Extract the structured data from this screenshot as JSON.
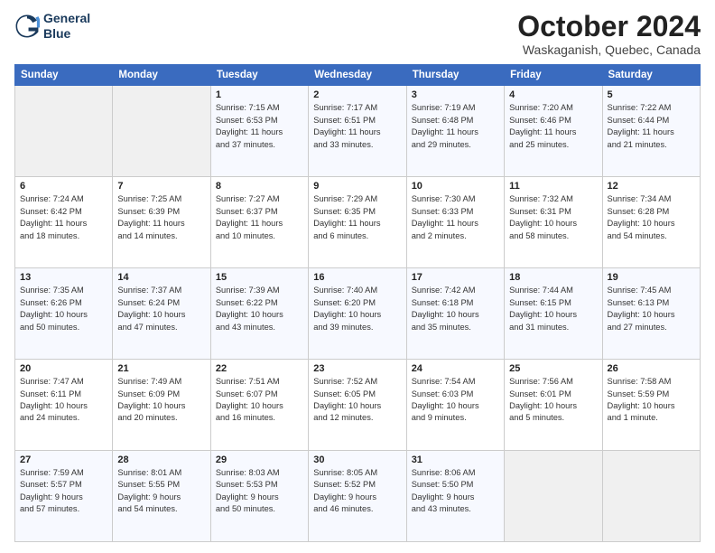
{
  "header": {
    "logo_line1": "General",
    "logo_line2": "Blue",
    "month_title": "October 2024",
    "location": "Waskaganish, Quebec, Canada"
  },
  "weekdays": [
    "Sunday",
    "Monday",
    "Tuesday",
    "Wednesday",
    "Thursday",
    "Friday",
    "Saturday"
  ],
  "weeks": [
    [
      {
        "day": "",
        "info": ""
      },
      {
        "day": "",
        "info": ""
      },
      {
        "day": "1",
        "info": "Sunrise: 7:15 AM\nSunset: 6:53 PM\nDaylight: 11 hours\nand 37 minutes."
      },
      {
        "day": "2",
        "info": "Sunrise: 7:17 AM\nSunset: 6:51 PM\nDaylight: 11 hours\nand 33 minutes."
      },
      {
        "day": "3",
        "info": "Sunrise: 7:19 AM\nSunset: 6:48 PM\nDaylight: 11 hours\nand 29 minutes."
      },
      {
        "day": "4",
        "info": "Sunrise: 7:20 AM\nSunset: 6:46 PM\nDaylight: 11 hours\nand 25 minutes."
      },
      {
        "day": "5",
        "info": "Sunrise: 7:22 AM\nSunset: 6:44 PM\nDaylight: 11 hours\nand 21 minutes."
      }
    ],
    [
      {
        "day": "6",
        "info": "Sunrise: 7:24 AM\nSunset: 6:42 PM\nDaylight: 11 hours\nand 18 minutes."
      },
      {
        "day": "7",
        "info": "Sunrise: 7:25 AM\nSunset: 6:39 PM\nDaylight: 11 hours\nand 14 minutes."
      },
      {
        "day": "8",
        "info": "Sunrise: 7:27 AM\nSunset: 6:37 PM\nDaylight: 11 hours\nand 10 minutes."
      },
      {
        "day": "9",
        "info": "Sunrise: 7:29 AM\nSunset: 6:35 PM\nDaylight: 11 hours\nand 6 minutes."
      },
      {
        "day": "10",
        "info": "Sunrise: 7:30 AM\nSunset: 6:33 PM\nDaylight: 11 hours\nand 2 minutes."
      },
      {
        "day": "11",
        "info": "Sunrise: 7:32 AM\nSunset: 6:31 PM\nDaylight: 10 hours\nand 58 minutes."
      },
      {
        "day": "12",
        "info": "Sunrise: 7:34 AM\nSunset: 6:28 PM\nDaylight: 10 hours\nand 54 minutes."
      }
    ],
    [
      {
        "day": "13",
        "info": "Sunrise: 7:35 AM\nSunset: 6:26 PM\nDaylight: 10 hours\nand 50 minutes."
      },
      {
        "day": "14",
        "info": "Sunrise: 7:37 AM\nSunset: 6:24 PM\nDaylight: 10 hours\nand 47 minutes."
      },
      {
        "day": "15",
        "info": "Sunrise: 7:39 AM\nSunset: 6:22 PM\nDaylight: 10 hours\nand 43 minutes."
      },
      {
        "day": "16",
        "info": "Sunrise: 7:40 AM\nSunset: 6:20 PM\nDaylight: 10 hours\nand 39 minutes."
      },
      {
        "day": "17",
        "info": "Sunrise: 7:42 AM\nSunset: 6:18 PM\nDaylight: 10 hours\nand 35 minutes."
      },
      {
        "day": "18",
        "info": "Sunrise: 7:44 AM\nSunset: 6:15 PM\nDaylight: 10 hours\nand 31 minutes."
      },
      {
        "day": "19",
        "info": "Sunrise: 7:45 AM\nSunset: 6:13 PM\nDaylight: 10 hours\nand 27 minutes."
      }
    ],
    [
      {
        "day": "20",
        "info": "Sunrise: 7:47 AM\nSunset: 6:11 PM\nDaylight: 10 hours\nand 24 minutes."
      },
      {
        "day": "21",
        "info": "Sunrise: 7:49 AM\nSunset: 6:09 PM\nDaylight: 10 hours\nand 20 minutes."
      },
      {
        "day": "22",
        "info": "Sunrise: 7:51 AM\nSunset: 6:07 PM\nDaylight: 10 hours\nand 16 minutes."
      },
      {
        "day": "23",
        "info": "Sunrise: 7:52 AM\nSunset: 6:05 PM\nDaylight: 10 hours\nand 12 minutes."
      },
      {
        "day": "24",
        "info": "Sunrise: 7:54 AM\nSunset: 6:03 PM\nDaylight: 10 hours\nand 9 minutes."
      },
      {
        "day": "25",
        "info": "Sunrise: 7:56 AM\nSunset: 6:01 PM\nDaylight: 10 hours\nand 5 minutes."
      },
      {
        "day": "26",
        "info": "Sunrise: 7:58 AM\nSunset: 5:59 PM\nDaylight: 10 hours\nand 1 minute."
      }
    ],
    [
      {
        "day": "27",
        "info": "Sunrise: 7:59 AM\nSunset: 5:57 PM\nDaylight: 9 hours\nand 57 minutes."
      },
      {
        "day": "28",
        "info": "Sunrise: 8:01 AM\nSunset: 5:55 PM\nDaylight: 9 hours\nand 54 minutes."
      },
      {
        "day": "29",
        "info": "Sunrise: 8:03 AM\nSunset: 5:53 PM\nDaylight: 9 hours\nand 50 minutes."
      },
      {
        "day": "30",
        "info": "Sunrise: 8:05 AM\nSunset: 5:52 PM\nDaylight: 9 hours\nand 46 minutes."
      },
      {
        "day": "31",
        "info": "Sunrise: 8:06 AM\nSunset: 5:50 PM\nDaylight: 9 hours\nand 43 minutes."
      },
      {
        "day": "",
        "info": ""
      },
      {
        "day": "",
        "info": ""
      }
    ]
  ]
}
